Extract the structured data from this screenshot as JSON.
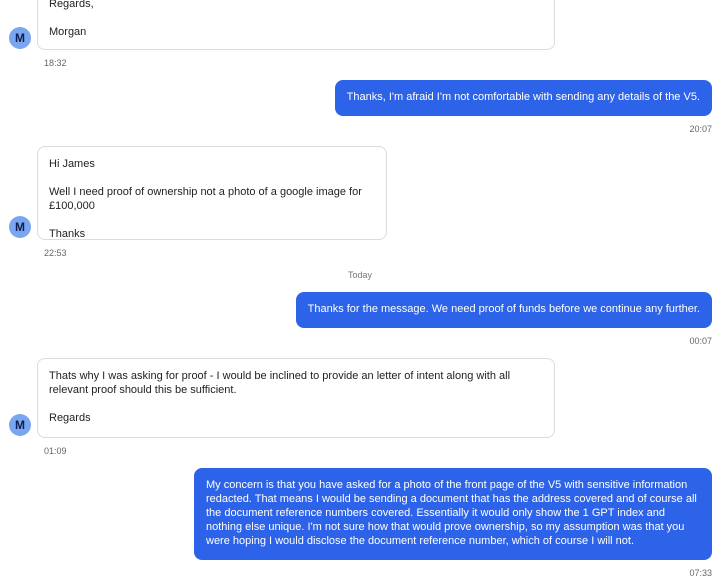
{
  "messages": [
    {
      "lines": [
        "Regards,",
        "Morgan"
      ],
      "time": "18:32",
      "avatar": "M"
    },
    {
      "text": "Thanks, I'm afraid I'm not comfortable with sending any details of the V5.",
      "time": "20:07"
    },
    {
      "lines": [
        "Hi James",
        "Well I need proof of ownership not a photo of a google image for £100,000",
        "Thanks"
      ],
      "time": "22:53",
      "avatar": "M"
    },
    {
      "text": "Thanks for the message. We need proof of funds before we continue any further.",
      "time": "00:07"
    },
    {
      "lines": [
        "Thats why I was asking for proof - I would be inclined to provide an letter of intent along with all relevant proof should this be sufficient.",
        "Regards"
      ],
      "time": "01:09",
      "avatar": "M"
    },
    {
      "text": "My concern is that you have asked for a photo of the front page of the V5 with sensitive information redacted. That means I would be sending a document that has the address covered and of course all the document reference numbers covered. Essentially it would only show the 1 GPT index and nothing else unique. I'm not sure how that would prove ownership, so my assumption was that you were hoping I would disclose the document reference number, which of course I will not.",
      "time": "07:33"
    }
  ],
  "divider": {
    "label": "Today"
  },
  "colors": {
    "outgoing": "#2d63e8",
    "avatar": "#7aa5f0"
  }
}
